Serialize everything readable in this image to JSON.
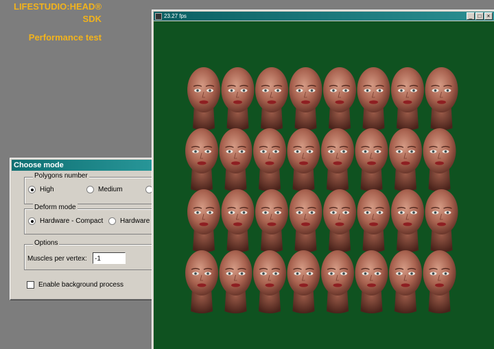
{
  "branding": {
    "title": "LIFESTUDIO:HEAD® SDK",
    "subtitle": "Performance test"
  },
  "dialog": {
    "title": "Choose mode",
    "polygons": {
      "legend": "Polygons number",
      "options": [
        "High",
        "Medium"
      ],
      "selected": "High"
    },
    "deform": {
      "legend": "Deform mode",
      "options": [
        "Hardware - Compact",
        "Hardware - I"
      ],
      "selected": "Hardware - Compact"
    },
    "options": {
      "legend": "Options",
      "muscles_label": "Muscles per vertex:",
      "muscles_value": "-1"
    },
    "background_checkbox_label": "Enable background process",
    "background_checked": false
  },
  "render_window": {
    "title": "23.27 fps",
    "buttons": [
      "_",
      "□",
      "×"
    ]
  },
  "colors": {
    "brand": "#f2b31c",
    "titlebar": "#0f6f72",
    "viewport_bg": "#0f5220",
    "skin": "#b57562"
  },
  "head_grid": {
    "rows": 4,
    "cols": 8
  }
}
